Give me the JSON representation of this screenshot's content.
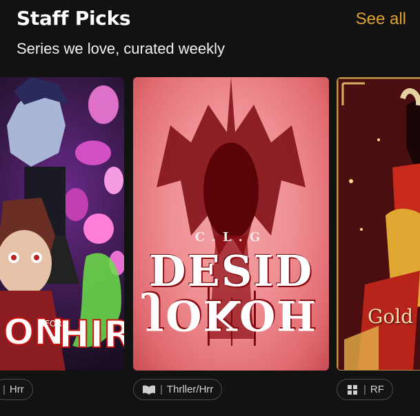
{
  "section": {
    "title": "Staff Picks",
    "see_all_label": "See all",
    "subtitle": "Series we love, curated weekly"
  },
  "cards": [
    {
      "cover_title": "ON FOR HIRE",
      "chip_icon": "book-icon",
      "genre": "Hrr"
    },
    {
      "cover_author": "C.L.G",
      "cover_title_top": "DESID",
      "cover_title_bottom": "JOKOH",
      "chip_icon": "book-open-icon",
      "genre": "Thrller/Hrr"
    },
    {
      "cover_title": "Gold a",
      "chip_icon": "grid-icon",
      "genre": "RF"
    }
  ],
  "colors": {
    "accent": "#e0a22e",
    "background": "#121212"
  }
}
